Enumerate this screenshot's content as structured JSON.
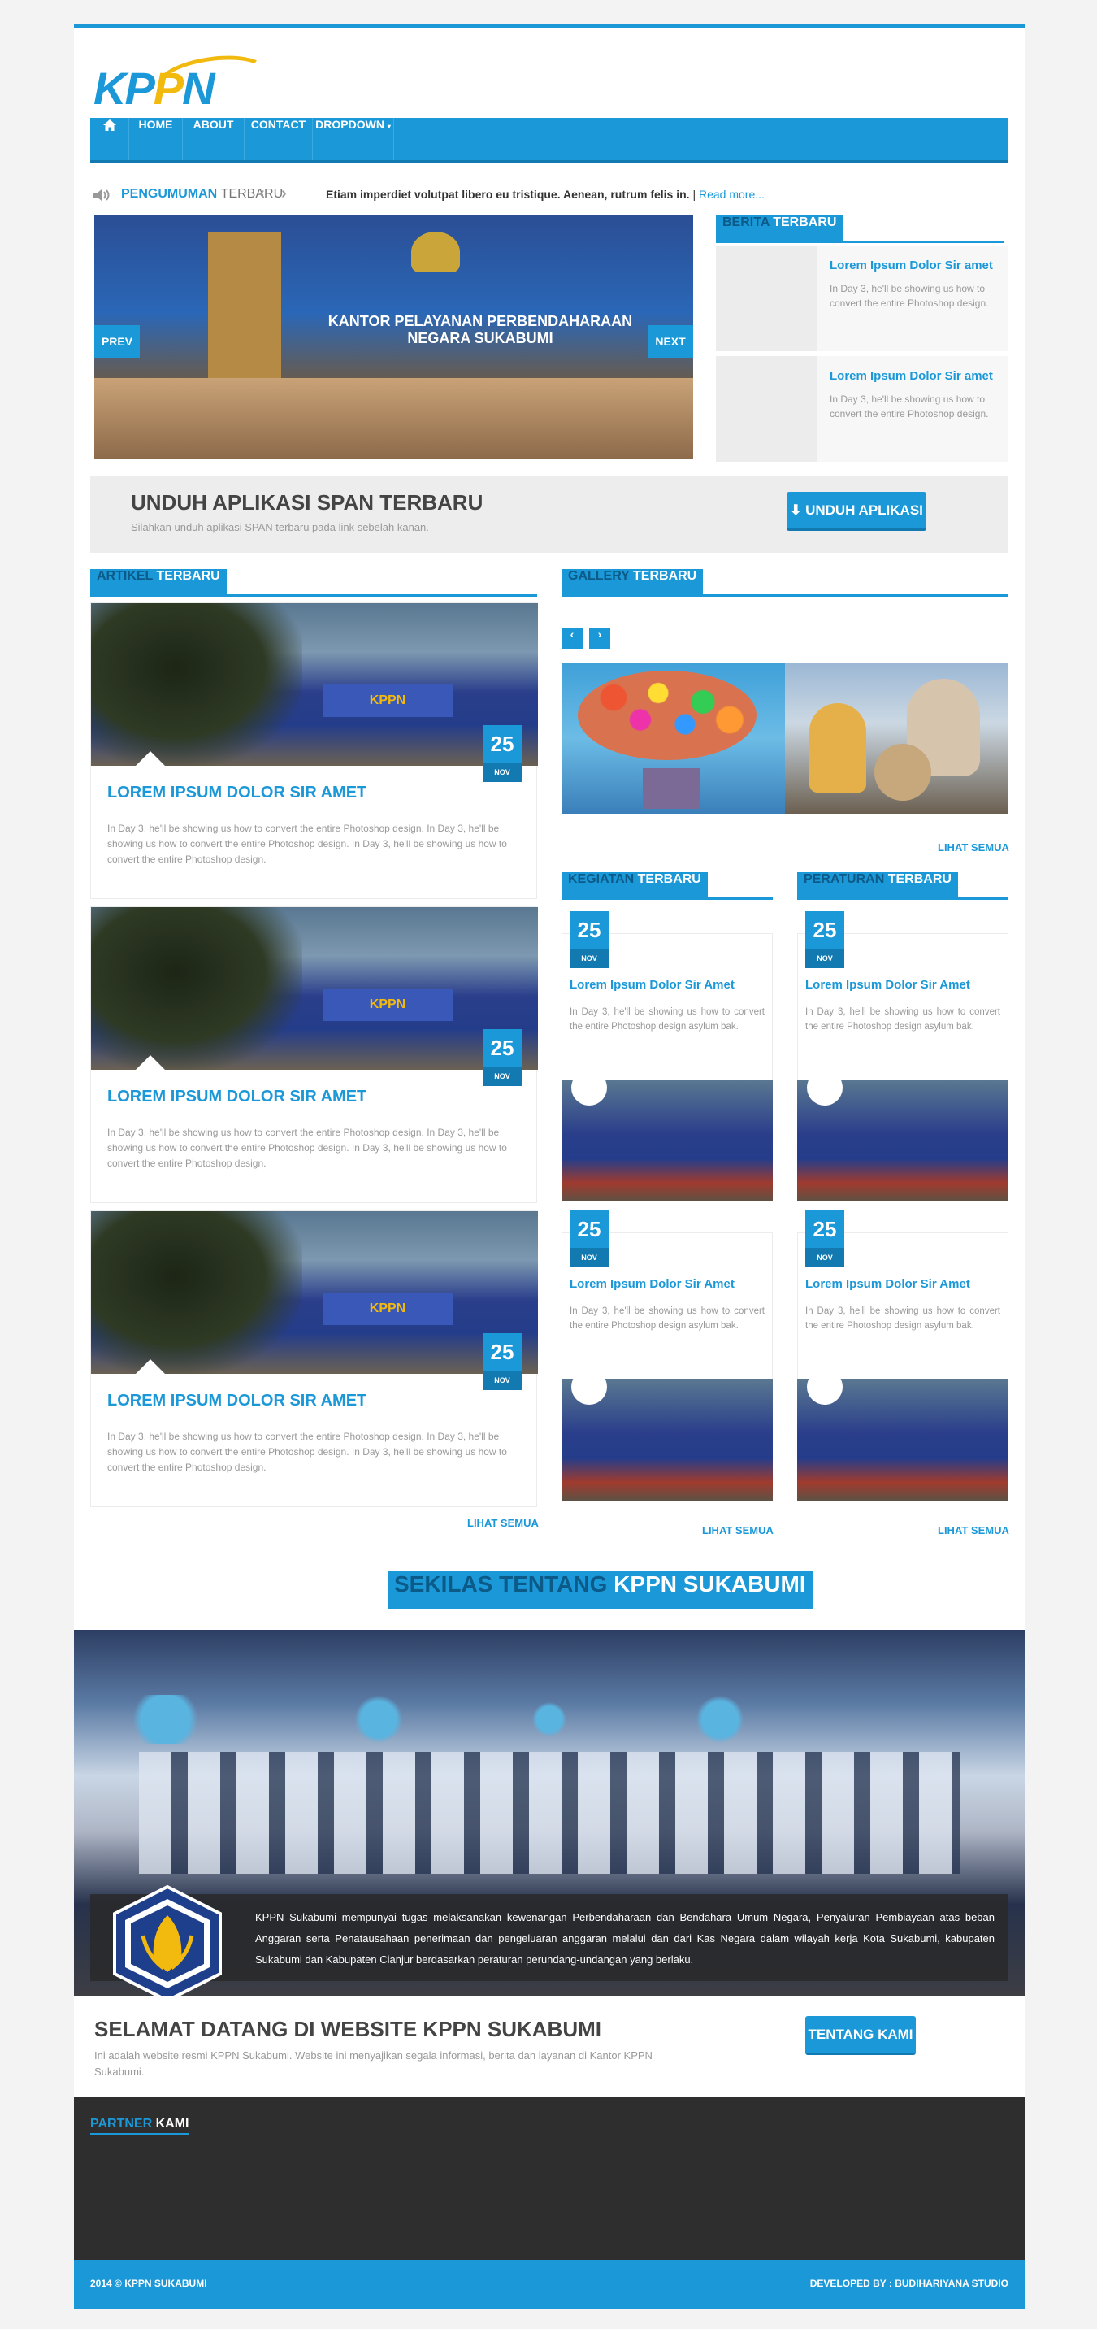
{
  "brand": {
    "logo_text_a": "KP",
    "logo_text_b": "P",
    "logo_text_c": "N",
    "accent": "#1b98d8",
    "accent_dark": "#137ab1",
    "logo_yellow": "#f2b90f"
  },
  "nav": {
    "home_icon": "home-icon",
    "items": [
      {
        "label": "HOME"
      },
      {
        "label": "ABOUT"
      },
      {
        "label": "CONTACT"
      },
      {
        "label": "DROPDOWN"
      }
    ]
  },
  "ticker": {
    "icon": "speaker-icon",
    "label_a": "PENGUMUMAN",
    "label_b": "TERBARU",
    "text": "Etiam imperdiet volutpat libero eu tristique. Aenean, rutrum felis in.",
    "separator": "|",
    "link": "Read more..."
  },
  "slider": {
    "sign": "KANTOR PELAYANAN PERBENDAHARAAN NEGARA SUKABUMI",
    "prev": "PREV",
    "next": "NEXT"
  },
  "berita": {
    "head_a": "BERITA",
    "head_b": "TERBARU",
    "items": [
      {
        "title": "Lorem Ipsum Dolor Sir amet",
        "desc": "In Day 3, he'll be showing us how to convert the entire Photoshop design."
      },
      {
        "title": "Lorem Ipsum Dolor Sir amet",
        "desc": "In Day 3, he'll be showing us how to convert the entire Photoshop design."
      }
    ]
  },
  "unduh": {
    "title": "UNDUH APLIKASI SPAN TERBARU",
    "sub": "Silahkan unduh aplikasi SPAN terbaru pada link sebelah kanan.",
    "button": "UNDUH APLIKASI",
    "button_icon": "download-icon"
  },
  "artikel": {
    "head_a": "ARTIKEL",
    "head_b": "TERBARU",
    "cards": [
      {
        "day": "25",
        "month": "NOV",
        "title": "LOREM IPSUM DOLOR SIR AMET",
        "desc": "In Day 3, he'll be showing us how to convert the entire Photoshop design. In Day 3, he'll be showing us how to convert the entire Photoshop design. In Day 3, he'll be showing us how to convert the entire Photoshop design."
      },
      {
        "day": "25",
        "month": "NOV",
        "title": "LOREM IPSUM DOLOR SIR AMET",
        "desc": "In Day 3, he'll be showing us how to convert the entire Photoshop design. In Day 3, he'll be showing us how to convert the entire Photoshop design. In Day 3, he'll be showing us how to convert the entire Photoshop design."
      },
      {
        "day": "25",
        "month": "NOV",
        "title": "LOREM IPSUM DOLOR SIR AMET",
        "desc": "In Day 3, he'll be showing us how to convert the entire Photoshop design. In Day 3, he'll be showing us how to convert the entire Photoshop design. In Day 3, he'll be showing us how to convert the entire Photoshop design."
      }
    ],
    "more": "LIHAT SEMUA"
  },
  "gallery": {
    "head_a": "GALLERY",
    "head_b": "TERBARU",
    "prev": "‹",
    "next": "›",
    "more": "LIHAT SEMUA"
  },
  "kegiatan": {
    "head_a": "KEGIATAN",
    "head_b": "TERBARU",
    "cards": [
      {
        "day": "25",
        "month": "NOV",
        "title": "Lorem Ipsum Dolor Sir Amet",
        "desc": "In Day 3, he'll be showing us how to convert the entire Photoshop design asylum bak."
      },
      {
        "day": "25",
        "month": "NOV",
        "title": "Lorem Ipsum Dolor Sir Amet",
        "desc": "In Day 3, he'll be showing us how to convert the entire Photoshop design asylum bak."
      }
    ],
    "more": "LIHAT SEMUA"
  },
  "peraturan": {
    "head_a": "PERATURAN",
    "head_b": "TERBARU",
    "cards": [
      {
        "day": "25",
        "month": "NOV",
        "title": "Lorem Ipsum Dolor Sir Amet",
        "desc": "In Day 3, he'll be showing us how to convert the entire Photoshop design asylum bak."
      },
      {
        "day": "25",
        "month": "NOV",
        "title": "Lorem Ipsum Dolor Sir Amet",
        "desc": "In Day 3, he'll be showing us how to convert the entire Photoshop design asylum bak."
      }
    ],
    "more": "LIHAT SEMUA"
  },
  "about": {
    "head_a": "SEKILAS TENTANG",
    "head_b": "KPPN SUKABUMI",
    "text": "KPPN Sukabumi mempunyai tugas melaksanakan kewenangan Perbendaharaan dan Bendahara Umum Negara, Penyaluran Pembiayaan atas beban Anggaran serta Penatausahaan penerimaan dan pengeluaran anggaran melalui dan dari Kas Negara dalam wilayah kerja Kota Sukabumi, kabupaten Sukabumi dan Kabupaten Cianjur berdasarkan peraturan perundang-undangan yang berlaku.",
    "welcome_title": "SELAMAT DATANG DI WEBSITE KPPN SUKABUMI",
    "welcome_desc": "Ini adalah website resmi KPPN Sukabumi. Website ini menyajikan segala informasi, berita dan layanan di Kantor KPPN Sukabumi.",
    "button": "TENTANG KAMI"
  },
  "partner": {
    "head_a": "PARTNER",
    "head_b": "KAMI"
  },
  "footer": {
    "left": "2014 © KPPN SUKABUMI",
    "right": "DEVELOPED BY : BUDIHARIYANA STUDIO"
  }
}
